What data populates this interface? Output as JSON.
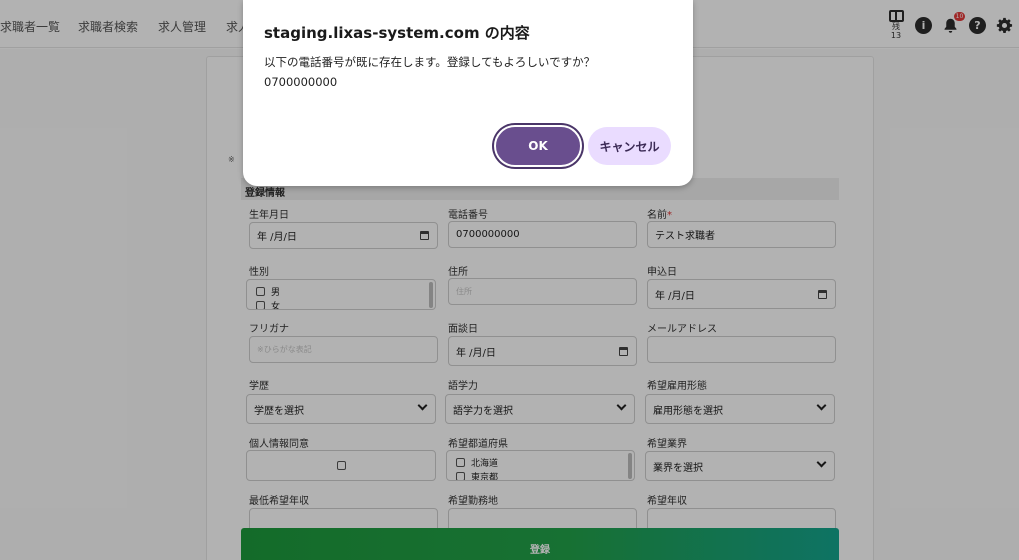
{
  "nav": {
    "items": [
      "求職者一覧",
      "求職者検索",
      "求人管理",
      "求人"
    ],
    "panel_label": "残\n13",
    "notification_count": "10"
  },
  "form": {
    "note": "※ ",
    "section_title": "登録情報",
    "fields": {
      "birthdate": {
        "label": "生年月日",
        "value": "年 /月/日"
      },
      "phone": {
        "label": "電話番号",
        "value": "0700000000"
      },
      "name": {
        "label": "名前",
        "required_mark": "*",
        "value": "テスト求職者"
      },
      "gender": {
        "label": "性別",
        "options": [
          "男",
          "女"
        ]
      },
      "address": {
        "label": "住所",
        "placeholder": "住所"
      },
      "apply_date": {
        "label": "申込日",
        "value": "年 /月/日"
      },
      "furigana": {
        "label": "フリガナ",
        "placeholder": "※ひらがな表記"
      },
      "interview_date": {
        "label": "面談日",
        "value": "年 /月/日"
      },
      "email": {
        "label": "メールアドレス",
        "value": ""
      },
      "education": {
        "label": "学歴",
        "value": "学歴を選択"
      },
      "language": {
        "label": "語学力",
        "value": "語学力を選択"
      },
      "employment_type": {
        "label": "希望雇用形態",
        "value": "雇用形態を選択"
      },
      "privacy_consent": {
        "label": "個人情報同意"
      },
      "prefecture": {
        "label": "希望都道府県",
        "options": [
          "北海道",
          "東京都"
        ]
      },
      "industry": {
        "label": "希望業界",
        "value": "業界を選択"
      },
      "min_salary": {
        "label": "最低希望年収"
      },
      "work_location": {
        "label": "希望勤務地"
      },
      "salary": {
        "label": "希望年収"
      }
    },
    "submit_label": "登録"
  },
  "dialog": {
    "title": "staging.lixas-system.com の内容",
    "message": "以下の電話番号が既に存在します。登録してもよろしいですか？",
    "phone": "0700000000",
    "ok_label": "OK",
    "cancel_label": "キャンセル"
  },
  "colors": {
    "ok_button": "#694e8e",
    "cancel_button": "#eadcff",
    "submit_start": "#1e9a3c",
    "submit_end": "#15a58f",
    "badge": "#e43b3b"
  }
}
